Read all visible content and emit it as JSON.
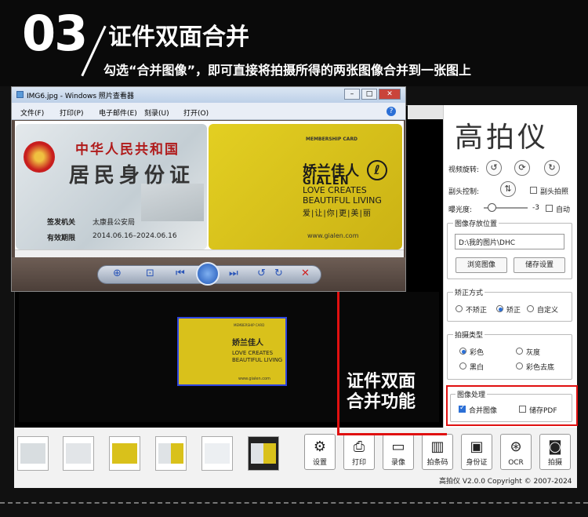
{
  "header": {
    "step_number": "03",
    "headline": "证件双面合并",
    "subline": "勾选“合并图像”，即可直接将拍摄所得的两张图像合并到一张图上"
  },
  "viewer": {
    "title": "IMG6.jpg - Windows 照片查看器",
    "menu": [
      "文件(F)",
      "打印(P)",
      "电子邮件(E)",
      "刻录(U)",
      "打开(O)"
    ],
    "help": "?"
  },
  "id_card": {
    "line1": "中华人民共和国",
    "line2": "居民身份证",
    "issuer_label": "签发机关",
    "issuer": "太康县公安局",
    "valid_label": "有效期限",
    "valid": "2014.06.16–2024.06.16"
  },
  "member_card": {
    "label": "MEMBERSHIP CARD",
    "brand_cn": "娇兰佳人",
    "brand_en": "GIALEN",
    "slogan1": "LOVE CREATES",
    "slogan2": "BEAUTIFUL LIVING",
    "slogan3": "爱|让|你|更|美|丽",
    "url": "www.gialen.com"
  },
  "right_panel": {
    "brand_title": "高拍仪",
    "rotate_label": "视频旋转:",
    "secondary_label": "副头控制:",
    "secondary_check": "副头拍照",
    "exposure_label": "曝光度:",
    "exposure_value": "-3",
    "auto_label": "自动",
    "save_group_title": "图像存放位置",
    "save_path": "D:\\我的图片\\DHC",
    "browse_btn": "浏览图像",
    "settings_btn": "储存设置",
    "correct_group_title": "矫正方式",
    "correct_options": [
      "不矫正",
      "矫正",
      "自定义"
    ],
    "type_group_title": "拍摄类型",
    "type_options": [
      "彩色",
      "灰度",
      "黑白",
      "彩色去底"
    ],
    "process_group_title": "图像处理",
    "merge_label": "合并图像",
    "pdf_label": "储存PDF"
  },
  "callout": {
    "line1": "证件双面",
    "line2": "合并功能"
  },
  "toolbar": {
    "buttons": [
      "设置",
      "打印",
      "录像",
      "拍条码",
      "身份证",
      "OCR",
      "拍摄"
    ]
  },
  "copyright": "高拍仪 V2.0.0 Copyright © 2007-2024",
  "colors": {
    "highlight": "#e01010",
    "accent": "#2b6fd6",
    "card_yellow": "#d9c11b"
  }
}
